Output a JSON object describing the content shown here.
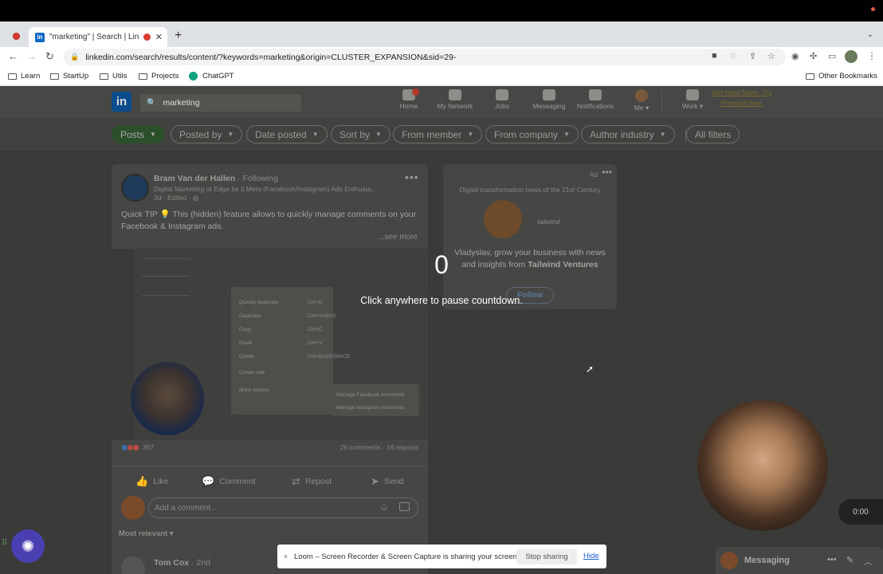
{
  "browser": {
    "tab_title": "\"marketing\" | Search | Linke",
    "new_tab_label": "+",
    "url": "linkedin.com/search/results/content/?keywords=marketing&origin=CLUSTER_EXPANSION&sid=29-",
    "bookmarks": [
      "Learn",
      "StartUp",
      "Utils",
      "Projects",
      "ChatGPT"
    ],
    "other_bookmarks": "Other Bookmarks"
  },
  "linkedin": {
    "logo": "in",
    "search_value": "marketing",
    "nav": {
      "home": "Home",
      "network": "My Network",
      "jobs": "Jobs",
      "messaging": "Messaging",
      "notifications": "Notifications",
      "me": "Me ▾",
      "work": "Work ▾"
    },
    "premium_promo": "Get hired faster. Try Premium free.",
    "filters": [
      "Posts",
      "Posted by",
      "Date posted",
      "Sort by",
      "From member",
      "From company",
      "Author industry"
    ],
    "all_filters": "All filters",
    "post": {
      "author": "Bram Van der Hallen",
      "follow_status": "· Following",
      "headline": "Digital Marketing at Edge.be || Meta (Facebook/Instagram) Ads Enthusia...",
      "meta": "3d · Edited · ",
      "text": "Quick TIP 💡 This (hidden) feature allows to quickly manage comments on your Facebook & Instagram ads.",
      "see_more": "...see more",
      "reaction_count": "357",
      "comments_reposts": "26 comments · 16 reposts",
      "actions": {
        "like": "Like",
        "comment": "Comment",
        "repost": "Repost",
        "send": "Send"
      },
      "comment_placeholder": "Add a comment...",
      "sort_label": "Most relevant ▾",
      "next_commenter": "Tom Cox",
      "next_degree": " · 2nd",
      "image_menu": {
        "rows": [
          "Quickly duplicate",
          "Duplicate",
          "Copy",
          "Paste",
          "Delete",
          "Create rule",
          "More options"
        ],
        "keys": [
          "Ctrl+D",
          "Ctrl+Shift+D",
          "Ctrl+C",
          "Ctrl+V",
          "Ctrl+BACKSPACE",
          "",
          ""
        ],
        "submenu": [
          "Manage Facebook comments",
          "Manage Instagram comments"
        ]
      }
    },
    "ad": {
      "label": "Ad",
      "subtitle": "Digital transformation news of the 21st Century",
      "brand": "tailwind",
      "text_prefix": "Vladyslav, grow your business with news and insights from ",
      "text_bold": "Tailwind Ventures",
      "follow": "Follow"
    },
    "messaging_label": "Messaging"
  },
  "loom": {
    "countdown": "0",
    "countdown_hint": "Click anywhere to pause countdown.",
    "timer": "0:00",
    "share_message": "Loom – Screen Recorder & Screen Capture is sharing your screen.",
    "stop_sharing": "Stop sharing",
    "hide": "Hide"
  }
}
